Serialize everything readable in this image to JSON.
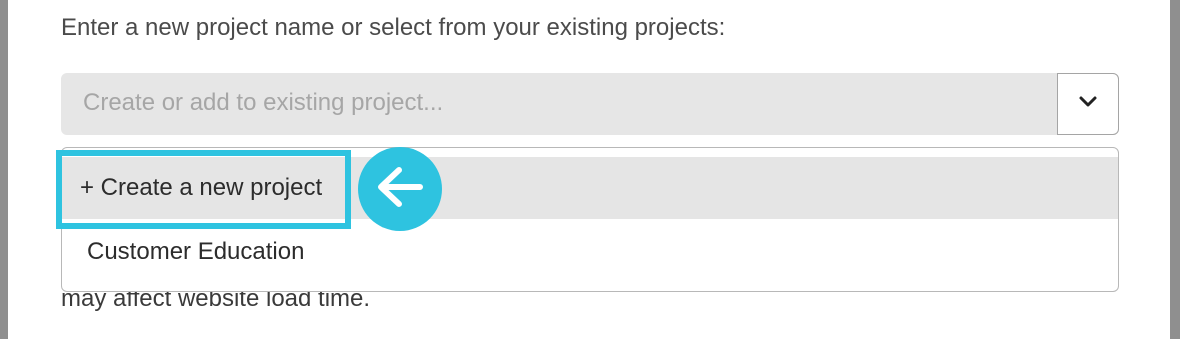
{
  "prompt": "Enter a new project name or select from your existing projects:",
  "combobox": {
    "placeholder": "Create or add to existing project...",
    "value": "",
    "toggle_icon": "chevron-down-icon"
  },
  "dropdown": {
    "options": [
      {
        "label": "+ Create a new project",
        "state": "hover"
      },
      {
        "label": "Customer Education",
        "state": "default"
      }
    ]
  },
  "annotation": {
    "highlight_color": "#2ec3e0",
    "arrow_icon": "arrow-left-icon"
  },
  "footer_text": "may affect website load time."
}
